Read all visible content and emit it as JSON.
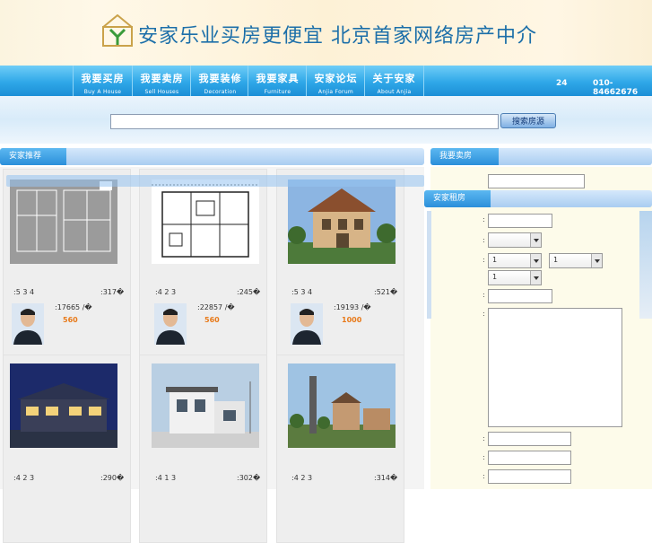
{
  "banner": {
    "slogan": "安家乐业买房更便宜   北京首家网络房产中介"
  },
  "nav": {
    "items": [
      {
        "cn": "我要买房",
        "en": "Buy A House"
      },
      {
        "cn": "我要卖房",
        "en": "Sell Houses"
      },
      {
        "cn": "我要装修",
        "en": "Decoration"
      },
      {
        "cn": "我要家具",
        "en": "Furniture"
      },
      {
        "cn": "安家论坛",
        "en": "Anjia Forum"
      },
      {
        "cn": "关于安家",
        "en": "About Anjia"
      }
    ],
    "hours": "24",
    "phone": "010-84662676"
  },
  "search": {
    "value": "",
    "button_label": "搜索房源"
  },
  "left_section": {
    "title": "安家推荐"
  },
  "cards": [
    {
      "left_meta": ":5 3 4",
      "right_meta": ":317�",
      "price": ":17665 /�",
      "commission": "560"
    },
    {
      "left_meta": ":4 2 3",
      "right_meta": ":245�",
      "price": ":22857 /�",
      "commission": "560"
    },
    {
      "left_meta": ":5 3 4",
      "right_meta": ":521�",
      "price": ":19193 /�",
      "commission": "1000"
    },
    {
      "left_meta": ":4 2 3",
      "right_meta": ":290�",
      "price": "",
      "commission": ""
    },
    {
      "left_meta": ":4 1 3",
      "right_meta": ":302�",
      "price": "",
      "commission": ""
    },
    {
      "left_meta": ":4 2 3",
      "right_meta": ":314�",
      "price": "",
      "commission": ""
    }
  ],
  "right_section": {
    "sell_title": "我要卖房",
    "rent_title": "安家租房",
    "select_a_value": "",
    "select_b_value": "1",
    "select_c_value": "1",
    "select_d_value": "1",
    "colon": ":"
  },
  "colors": {
    "nav_blue": "#2fa7e8",
    "accent_orange": "#e87a1a",
    "slogan_blue": "#1c6fa9"
  }
}
